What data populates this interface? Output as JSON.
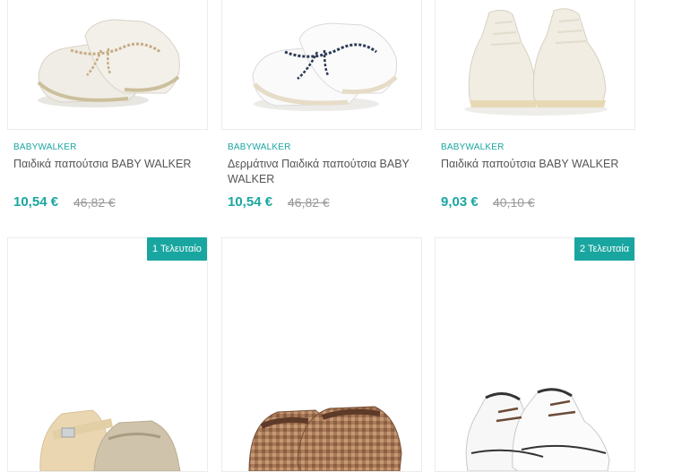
{
  "products": [
    {
      "brand": "BABYWALKER",
      "name": "Παιδικά παπούτσια BABY WALKER",
      "price": "10,54 €",
      "old_price": "46,82 €"
    },
    {
      "brand": "BABYWALKER",
      "name": "Δερμάτινα Παιδικά παπούτσια BABY WALKER",
      "price": "10,54 €",
      "old_price": "46,82 €"
    },
    {
      "brand": "BABYWALKER",
      "name": "Παιδικά παπούτσια BABY WALKER",
      "price": "9,03 €",
      "old_price": "40,10 €"
    }
  ],
  "badges": [
    "1 Τελευταίο",
    "2 Τελευταία"
  ],
  "colors": {
    "accent": "#1aa6a0",
    "border": "#ececec",
    "old_price": "#999999"
  }
}
